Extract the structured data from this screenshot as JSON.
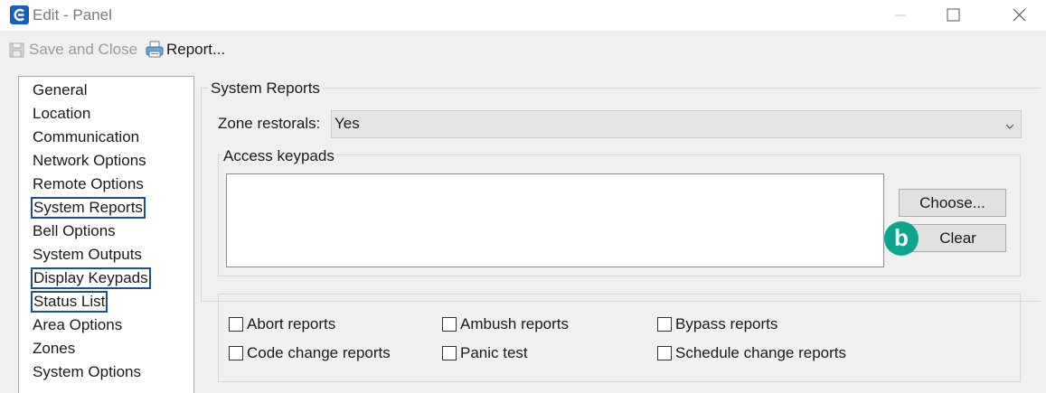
{
  "window": {
    "title": "Edit - Panel",
    "icon": "app-logo-icon",
    "controls": [
      "minimize-icon",
      "maximize-icon",
      "close-icon"
    ]
  },
  "toolbar": {
    "save_label": "Save and Close",
    "report_label": "Report..."
  },
  "sidebar": {
    "items": [
      {
        "label": "General",
        "highlighted": false
      },
      {
        "label": "Location",
        "highlighted": false
      },
      {
        "label": "Communication",
        "highlighted": false
      },
      {
        "label": "Network Options",
        "highlighted": false
      },
      {
        "label": "Remote Options",
        "highlighted": false
      },
      {
        "label": "System Reports",
        "highlighted": true
      },
      {
        "label": "Bell Options",
        "highlighted": false
      },
      {
        "label": "System Outputs",
        "highlighted": false
      },
      {
        "label": "Display Keypads",
        "highlighted": true
      },
      {
        "label": "Status List",
        "highlighted": true
      },
      {
        "label": "Area Options",
        "highlighted": false
      },
      {
        "label": "Zones",
        "highlighted": false
      },
      {
        "label": "System Options",
        "highlighted": false
      }
    ]
  },
  "main": {
    "group_title": "System Reports",
    "zone_restorals": {
      "label": "Zone restorals:",
      "value": "Yes"
    },
    "access_keypads": {
      "label": "Access keypads",
      "choose_label": "Choose...",
      "clear_label": "Clear",
      "marker": "b"
    },
    "checkboxes": [
      {
        "label": "Abort reports",
        "checked": false
      },
      {
        "label": "Ambush reports",
        "checked": false
      },
      {
        "label": "Bypass reports",
        "checked": false
      },
      {
        "label": "Code change reports",
        "checked": false
      },
      {
        "label": "Panic test",
        "checked": false
      },
      {
        "label": "Schedule change reports",
        "checked": false
      }
    ]
  },
  "colors": {
    "highlight_border": "#1e4f8c",
    "marker_bg": "#0ea58e",
    "app_icon": "#1560b8"
  }
}
